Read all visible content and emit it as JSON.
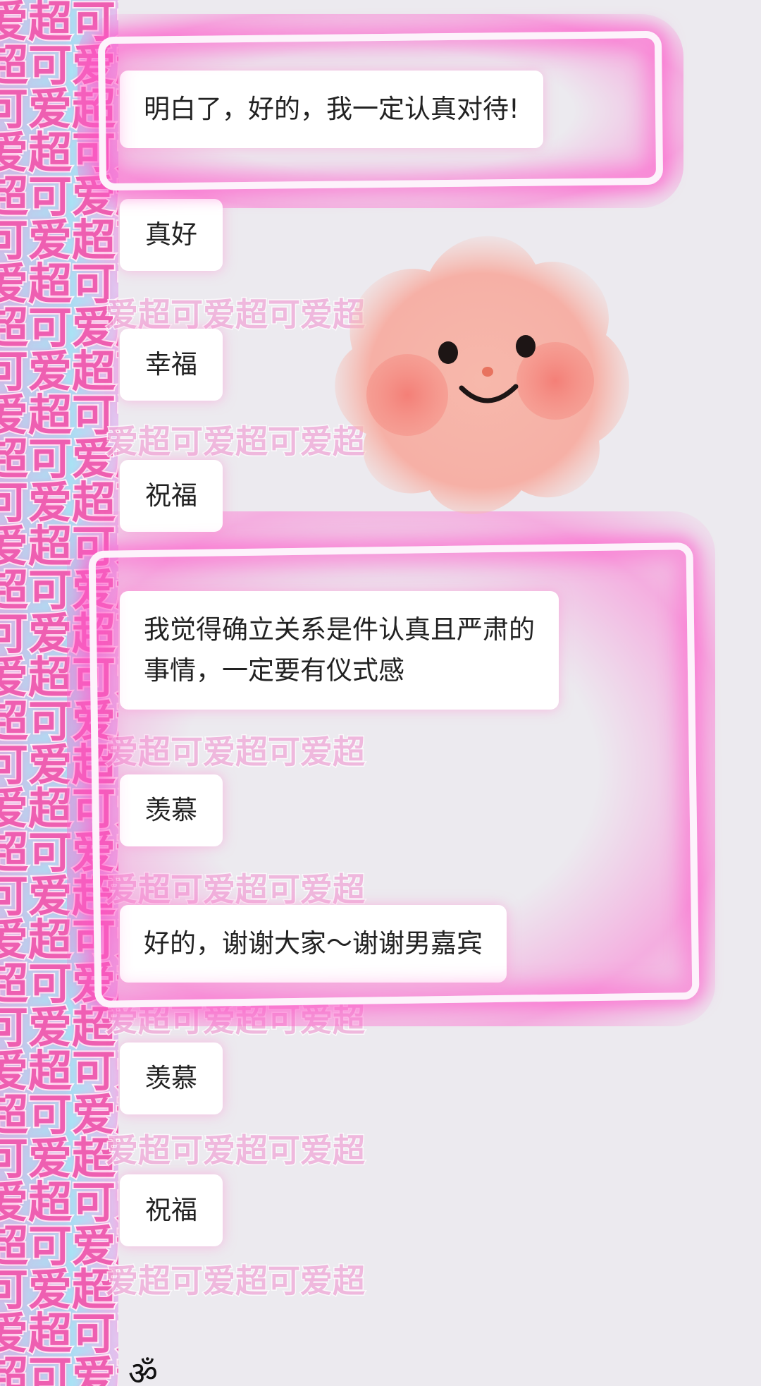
{
  "sticker": {
    "rows": [
      "爱超可爱超",
      "超可爱超可",
      "可爱超可爱",
      "爱超可爱超",
      "超可爱超可",
      "可爱超可爱",
      "爱超可爱超",
      "超可爱超可",
      "可爱超可爱",
      "爱超可爱超",
      "超可爱超可",
      "可爱超可爱",
      "爱超可爱超",
      "超可爱超可",
      "可爱超可爱",
      "爱超可爱超",
      "超可爱超可",
      "可爱超可爱",
      "爱超可爱超",
      "超可爱超可",
      "可爱超可爱",
      "爱超可爱超",
      "超可爱超可",
      "可爱超可爱",
      "爱超可爱超",
      "超可爱超可",
      "可爱超可爱",
      "爱超可爱超",
      "超可爱超可",
      "可爱超可爱",
      "爱超可爱超",
      "超可爱超可"
    ],
    "bleed_text": "爱超可爱超可爱超",
    "color": "#ee5fb1"
  },
  "messages": [
    {
      "id": "m1",
      "text": "明白了，好的，我一定认真对待!"
    },
    {
      "id": "m2",
      "text": "真好"
    },
    {
      "id": "m3",
      "text": "幸福"
    },
    {
      "id": "m4",
      "text": "祝福"
    },
    {
      "id": "m5",
      "line1": "我觉得确立关系是件认真且严肃的",
      "line2": "事情，一定要有仪式感"
    },
    {
      "id": "m6",
      "text": "羡慕"
    },
    {
      "id": "m7",
      "text": "好的，谢谢大家～谢谢男嘉宾"
    },
    {
      "id": "m8",
      "text": "羡慕"
    },
    {
      "id": "m9",
      "text": "祝福"
    }
  ],
  "decorations": {
    "fluffy_sticker": "blush-face-sticker",
    "highlight_color": "#ff50c8",
    "bottom_mark": "ॐ"
  }
}
